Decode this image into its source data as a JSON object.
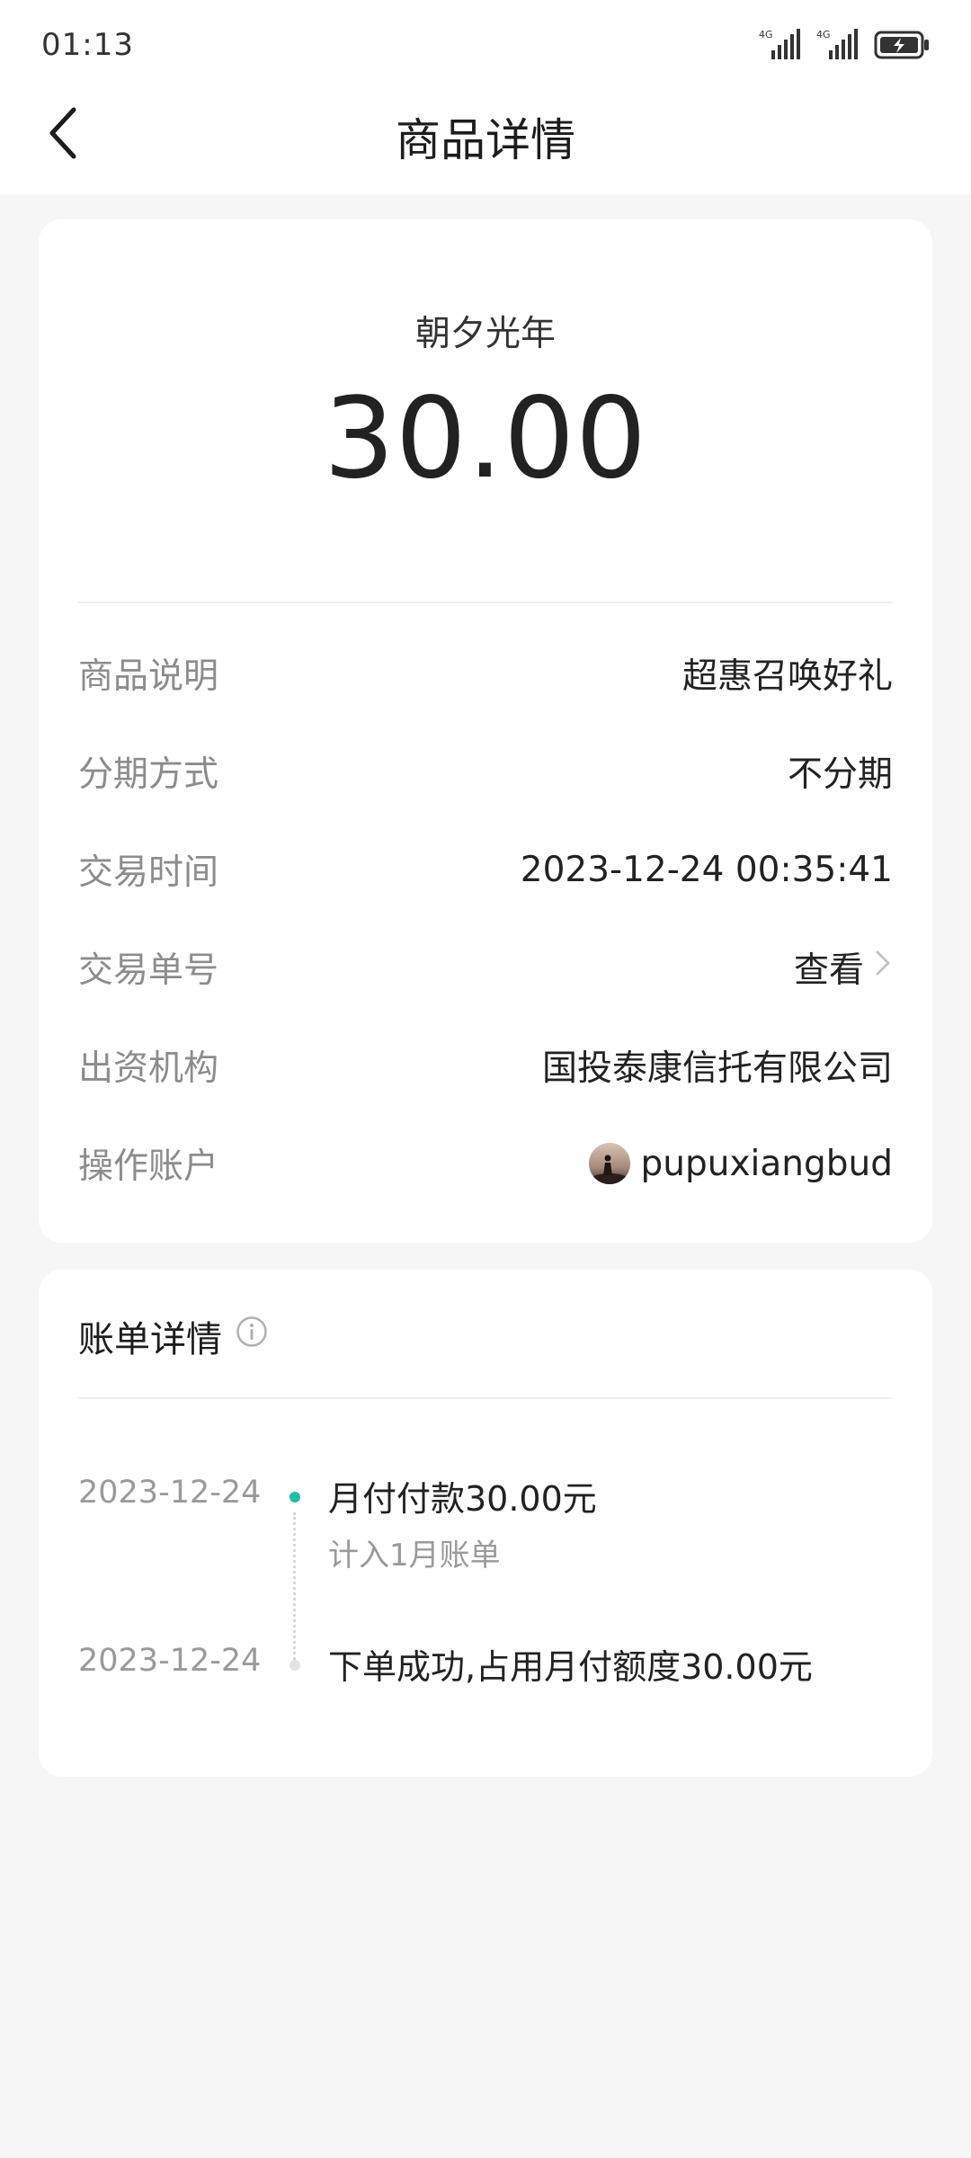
{
  "status_bar": {
    "time": "01:13",
    "signal1_label": "4G",
    "signal2_label": "4G",
    "icons": [
      "signal-icon",
      "signal-icon",
      "battery-charging-icon"
    ]
  },
  "nav": {
    "back_icon": "back-arrow-icon",
    "title": "商品详情"
  },
  "product": {
    "name": "朝夕光年",
    "amount": "30.00"
  },
  "details": [
    {
      "label": "商品说明",
      "value": "超惠召唤好礼"
    },
    {
      "label": "分期方式",
      "value": "不分期"
    },
    {
      "label": "交易时间",
      "value": "2023-12-24 00:35:41"
    },
    {
      "label": "交易单号",
      "value": "查看"
    },
    {
      "label": "出资机构",
      "value": "国投泰康信托有限公司"
    },
    {
      "label": "操作账户",
      "value": "pupuxiangbud"
    }
  ],
  "bill": {
    "title": "账单详情",
    "info_icon": "info-icon",
    "timeline": [
      {
        "date": "2023-12-24",
        "text": "月付付款30.00元",
        "sub": "计入1月账单",
        "dot_color": "#1bc0a6"
      },
      {
        "date": "2023-12-24",
        "text": "下单成功,占用月付额度30.00元",
        "sub": "",
        "dot_color": "#e3e3e3"
      }
    ]
  }
}
